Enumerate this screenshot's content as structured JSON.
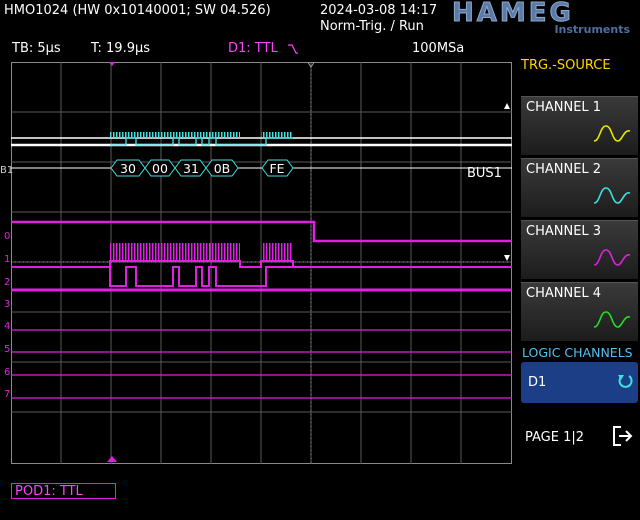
{
  "header": {
    "device": "HMO1024 (HW 0x10140001; SW 04.526)",
    "datetime": "2024-03-08 14:17",
    "trigger_mode": "Norm-Trig. / Run",
    "logo": "HAMEG",
    "logo_sub": "Instruments"
  },
  "status": {
    "timebase": "TB: 5µs",
    "trigger_time": "T: 19.9µs",
    "trigger_source": "D1: TTL",
    "trigger_slope_icon": "falling-edge-icon",
    "sample_rate": "100MSa"
  },
  "waveform": {
    "bus_name": "BUS1",
    "bus_marker": "B1",
    "bus_bytes": [
      "30",
      "00",
      "31",
      "0B",
      "FE"
    ],
    "logic_channel_labels": [
      "0",
      "1",
      "2",
      "3",
      "4",
      "5",
      "6",
      "7"
    ]
  },
  "sidebar": {
    "title": "TRG.-SOURCE",
    "channels": [
      {
        "label": "CHANNEL 1",
        "color": "#e8e800"
      },
      {
        "label": "CHANNEL 2",
        "color": "#40e0e0"
      },
      {
        "label": "CHANNEL 3",
        "color": "#e020e0"
      },
      {
        "label": "CHANNEL 4",
        "color": "#20e020"
      }
    ],
    "logic_title": "LOGIC CHANNELS",
    "logic_selected": "D1",
    "page": "PAGE 1|2"
  },
  "footer": {
    "pod_label": "POD1: TTL"
  },
  "colors": {
    "logic": "#e020e0",
    "bus": "#40e0e0",
    "grid": "#808080",
    "accent": "#ffd500"
  }
}
